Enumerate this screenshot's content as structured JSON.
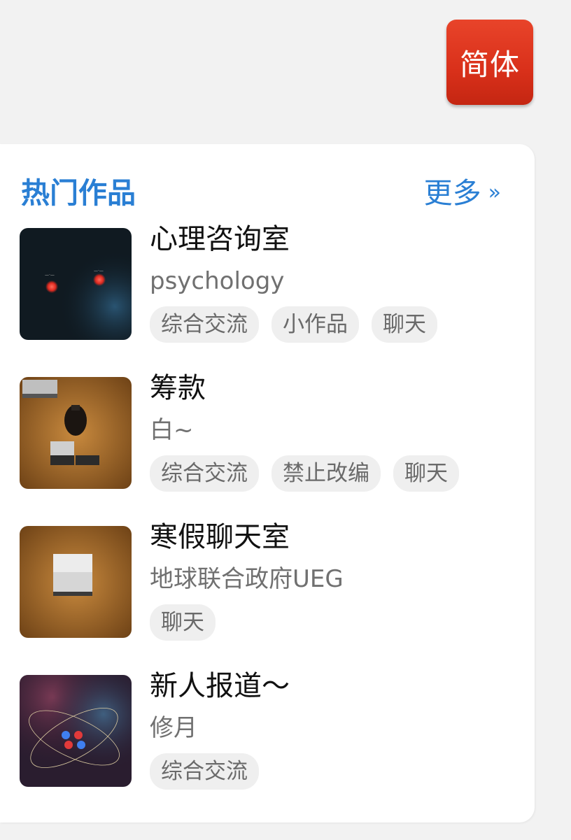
{
  "lang_button": {
    "label": "简体"
  },
  "section": {
    "title": "热门作品",
    "more_label": "更多",
    "more_arrow": "»"
  },
  "works": [
    {
      "title": "心理咨询室",
      "author": "psychology",
      "tags": [
        "综合交流",
        "小作品",
        "聊天"
      ],
      "thumbnail": "dark-space-red-dots"
    },
    {
      "title": "筹款",
      "author": "白~",
      "tags": [
        "综合交流",
        "禁止改编",
        "聊天"
      ],
      "thumbnail": "wood-table-devices"
    },
    {
      "title": "寒假聊天室",
      "author": "地球联合政府UEG",
      "tags": [
        "聊天"
      ],
      "thumbnail": "wood-table-box"
    },
    {
      "title": "新人报道～",
      "author": "修月",
      "tags": [
        "综合交流"
      ],
      "thumbnail": "nebula-atom"
    }
  ],
  "colors": {
    "accent": "#2a7fd4",
    "lang_button_bg": "#d9301a",
    "tag_bg": "#efefef"
  }
}
